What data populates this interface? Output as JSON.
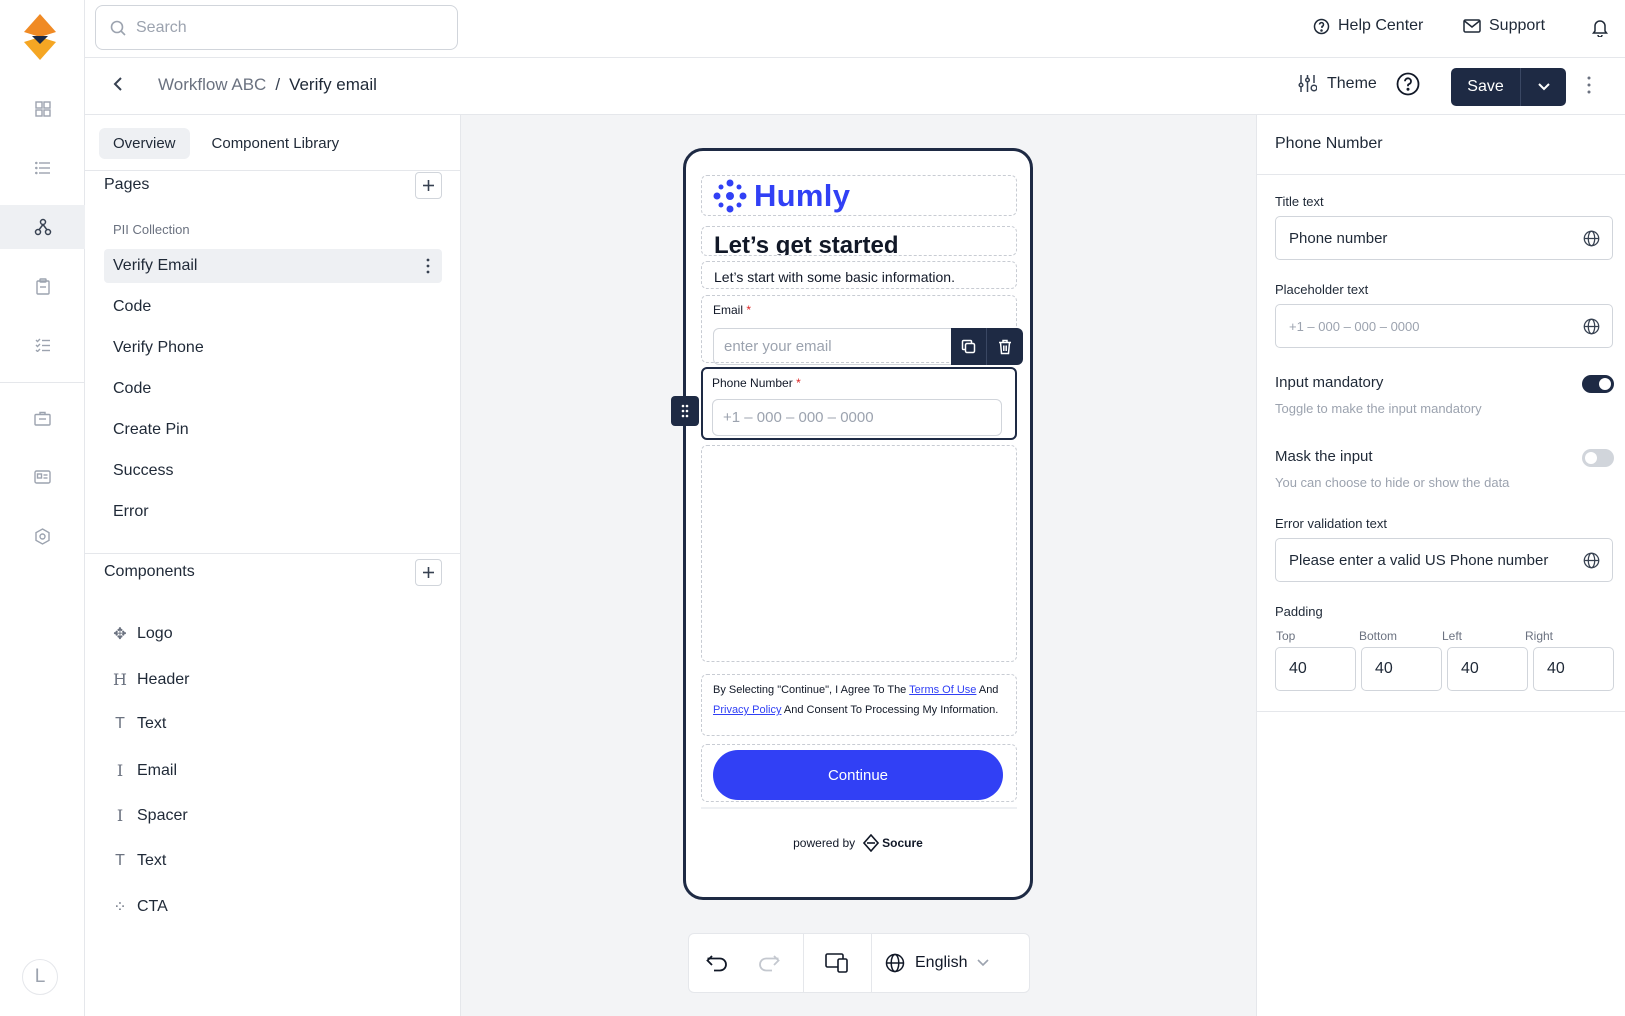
{
  "topbar": {
    "search_placeholder": "Search",
    "help_center": "Help Center",
    "support": "Support"
  },
  "subbar": {
    "breadcrumb_parent": "Workflow ABC",
    "breadcrumb_sep": "/",
    "breadcrumb_current": "Verify email",
    "theme_label": "Theme",
    "save_label": "Save"
  },
  "rail": {
    "avatar_initial": "L"
  },
  "leftpanel": {
    "tabs": [
      "Overview",
      "Component Library"
    ],
    "pages_title": "Pages",
    "pages_group": "PII Collection",
    "pages": [
      "Verify Email",
      "Code",
      "Verify Phone",
      "Code",
      "Create Pin",
      "Success",
      "Error"
    ],
    "components_title": "Components",
    "components": [
      {
        "label": "Logo",
        "icon": "✥"
      },
      {
        "label": "Header",
        "icon": "H"
      },
      {
        "label": "Text",
        "icon": "T"
      },
      {
        "label": "Email",
        "icon": "I"
      },
      {
        "label": "Spacer",
        "icon": "I"
      },
      {
        "label": "Text",
        "icon": "T"
      },
      {
        "label": "CTA",
        "icon": "⁘"
      }
    ]
  },
  "phone": {
    "brand": "Humly",
    "heading": "Let’s get started",
    "subtext": "Let’s start with some basic information.",
    "email_label": "Email",
    "email_placeholder": "enter your email",
    "phone_label": "Phone Number",
    "phone_placeholder": "+1 – 000 – 000 – 0000",
    "required_mark": "*",
    "terms_pre": "By Selecting \"Continue\", I Agree To The ",
    "terms_link": "Terms Of Use",
    "terms_mid": " And ",
    "privacy_link": "Privacy Policy",
    "terms_post": " And Consent To Processing My Information.",
    "continue_label": "Continue",
    "powered_by": "powered by",
    "socure": "Socure"
  },
  "toolbar": {
    "language": "English"
  },
  "rightpanel": {
    "title": "Phone Number",
    "title_text_label": "Title text",
    "title_text_value": "Phone number",
    "placeholder_label": "Placeholder text",
    "placeholder_value": "+1 – 000 – 000 – 0000",
    "mandatory_title": "Input mandatory",
    "mandatory_desc": "Toggle to make the input mandatory",
    "mandatory_on": true,
    "mask_title": "Mask the input",
    "mask_desc": "You can choose to hide or show the data",
    "mask_on": false,
    "error_label": "Error validation text",
    "error_value": "Please enter a valid US Phone number",
    "padding_label": "Padding",
    "padding": [
      {
        "label": "Top",
        "value": "40"
      },
      {
        "label": "Bottom",
        "value": "40"
      },
      {
        "label": "Left",
        "value": "40"
      },
      {
        "label": "Right",
        "value": "40"
      }
    ]
  },
  "colors": {
    "brand_blue": "#3140f5",
    "navy": "#1e2a44",
    "logo_orange": "#f08a24"
  }
}
